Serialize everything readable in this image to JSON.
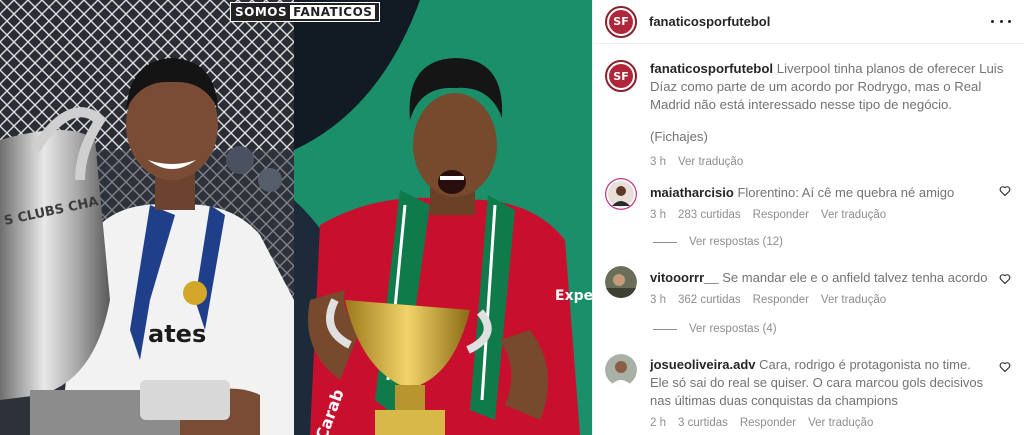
{
  "image": {
    "watermark_left": "SOMOS",
    "watermark_right": "FANATICOS"
  },
  "post": {
    "username": "fanaticosporfutebol",
    "avatar_initials": "SF",
    "caption": "Liverpool tinha planos de oferecer Luis Díaz como parte de um acordo por Rodrygo, mas o Real Madrid não está interessado nesse tipo de negócio.",
    "caption_source": "(Fichajes)",
    "time": "3 h",
    "translate": "Ver tradução"
  },
  "comments": [
    {
      "username": "maiatharcisio",
      "text": "Florentino: Aí cê me quebra né amigo",
      "time": "3 h",
      "likes": "283 curtidas",
      "reply": "Responder",
      "translate": "Ver tradução",
      "view_replies": "Ver respostas (12)"
    },
    {
      "username": "vitooorrr__",
      "text": "Se mandar ele e o anfield talvez tenha acordo",
      "time": "3 h",
      "likes": "362 curtidas",
      "reply": "Responder",
      "translate": "Ver tradução",
      "view_replies": "Ver respostas (4)"
    },
    {
      "username": "josueoliveira.adv",
      "text": "Cara, rodrigo é protagonista no time. Ele só sai do real se quiser. O cara marcou gols decisivos nas últimas duas conquistas da champions",
      "time": "2 h",
      "likes": "3 curtidas",
      "reply": "Responder",
      "translate": "Ver tradução"
    }
  ],
  "colors": {
    "brand_red": "#b0263b",
    "liverpool_red": "#c8102e",
    "turf_green": "#1a8f6a",
    "text_muted": "#737373"
  }
}
